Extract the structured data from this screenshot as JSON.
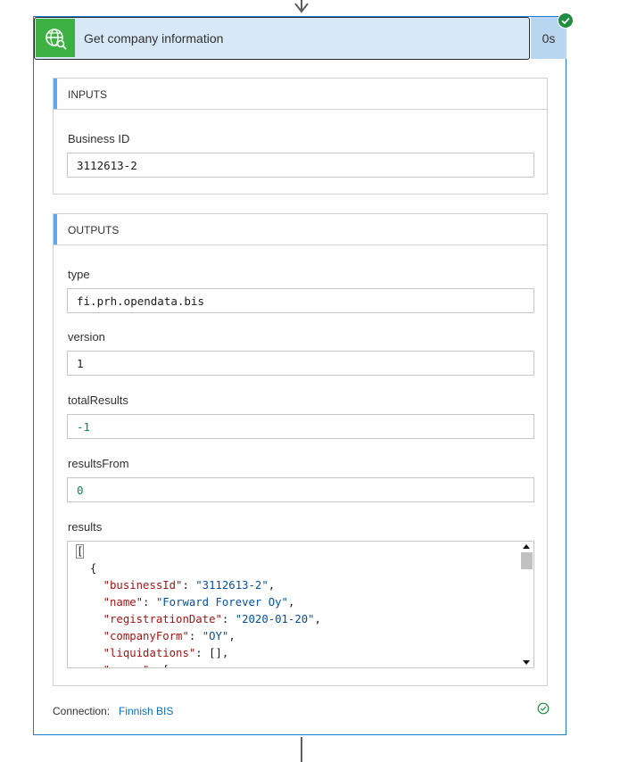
{
  "action": {
    "title": "Get company information",
    "duration": "0s"
  },
  "inputs": {
    "header": "INPUTS",
    "fields": [
      {
        "label": "Business ID",
        "value": "3112613-2"
      }
    ]
  },
  "outputs": {
    "header": "OUTPUTS",
    "type": {
      "label": "type",
      "value": "fi.prh.opendata.bis"
    },
    "version": {
      "label": "version",
      "value": "1"
    },
    "totalResults": {
      "label": "totalResults",
      "value": "-1"
    },
    "resultsFrom": {
      "label": "resultsFrom",
      "value": "0"
    },
    "results": {
      "label": "results",
      "lines": [
        {
          "indent": "",
          "parts": [
            {
              "t": "[",
              "c": "p"
            }
          ]
        },
        {
          "indent": "  ",
          "parts": [
            {
              "t": "{",
              "c": "p"
            }
          ]
        },
        {
          "indent": "    ",
          "parts": [
            {
              "t": "\"businessId\"",
              "c": "k"
            },
            {
              "t": ": ",
              "c": "p"
            },
            {
              "t": "\"3112613-2\"",
              "c": "s"
            },
            {
              "t": ",",
              "c": "p"
            }
          ]
        },
        {
          "indent": "    ",
          "parts": [
            {
              "t": "\"name\"",
              "c": "k"
            },
            {
              "t": ": ",
              "c": "p"
            },
            {
              "t": "\"Forward Forever Oy\"",
              "c": "s"
            },
            {
              "t": ",",
              "c": "p"
            }
          ]
        },
        {
          "indent": "    ",
          "parts": [
            {
              "t": "\"registrationDate\"",
              "c": "k"
            },
            {
              "t": ": ",
              "c": "p"
            },
            {
              "t": "\"2020-01-20\"",
              "c": "s"
            },
            {
              "t": ",",
              "c": "p"
            }
          ]
        },
        {
          "indent": "    ",
          "parts": [
            {
              "t": "\"companyForm\"",
              "c": "k"
            },
            {
              "t": ": ",
              "c": "p"
            },
            {
              "t": "\"OY\"",
              "c": "s"
            },
            {
              "t": ",",
              "c": "p"
            }
          ]
        },
        {
          "indent": "    ",
          "parts": [
            {
              "t": "\"liquidations\"",
              "c": "k"
            },
            {
              "t": ": [],",
              "c": "p"
            }
          ]
        },
        {
          "indent": "    ",
          "parts": [
            {
              "t": "\"names\"",
              "c": "k"
            },
            {
              "t": ": [",
              "c": "p"
            }
          ]
        }
      ]
    }
  },
  "footer": {
    "connection_label": "Connection:",
    "connection_name": "Finnish BIS"
  },
  "colors": {
    "accent": "#60a5ea",
    "icon_bg": "#3cb043",
    "title_bg": "#d7e8f7",
    "link": "#0f6cbd",
    "success": "#1e8e3e"
  },
  "icons": {
    "app": "globe-search-icon",
    "status": "checkmark-circle-icon",
    "arrow": "arrow-down-icon"
  }
}
